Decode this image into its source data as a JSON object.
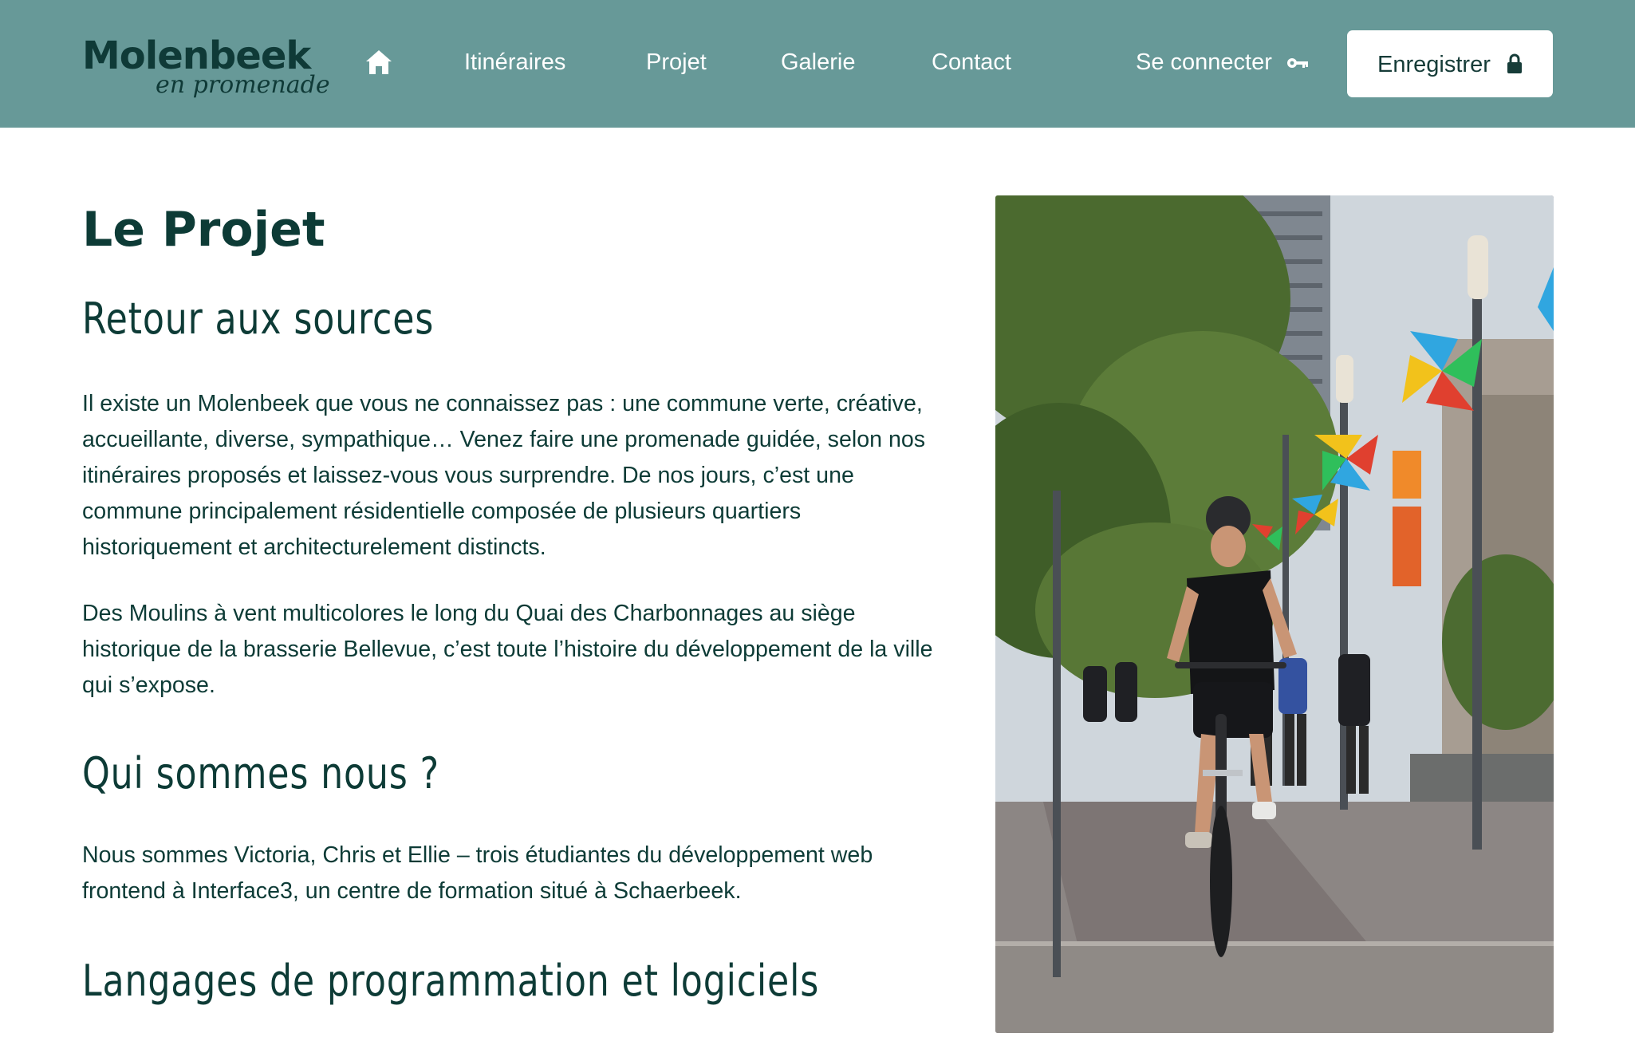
{
  "nav": {
    "logo": {
      "main": "Molenbeek",
      "sub": "en promenade"
    },
    "home_icon": "home-icon",
    "links": [
      "Itinéraires",
      "Projet",
      "Galerie",
      "Contact"
    ],
    "login_label": "Se connecter",
    "login_icon": "key-icon",
    "register_label": "Enregistrer",
    "register_icon": "lock-icon",
    "background": "#679998"
  },
  "main": {
    "title": "Le Projet",
    "sections": [
      {
        "heading": "Retour aux sources",
        "paragraphs": [
          "Il existe un Molenbeek que vous ne connaissez pas : une commune verte, créative, accueillante, diverse, sympathique… Venez faire une promenade guidée, selon nos itinéraires proposés et laissez-vous vous surprendre. De nos jours, c’est une commune principalement résidentielle composée de plusieurs quartiers historiquement et architecturelement distincts.",
          "Des Moulins à vent multicolores le long du Quai des Charbonnages au siège historique de la brasserie Bellevue, c’est toute l’histoire du développement de la ville qui s’expose."
        ]
      },
      {
        "heading": "Qui sommes nous ?",
        "paragraphs": [
          "Nous sommes Victoria, Chris et Ellie – trois étudiantes du développement web frontend à Interface3, un centre de formation situé à Schaerbeek."
        ]
      },
      {
        "heading": "Langages de programmation et logiciels",
        "paragraphs": []
      }
    ],
    "photo_subject": "cyclist-on-canal-quay-photo"
  },
  "colors": {
    "nav_bg": "#679998",
    "text_dark": "#0d3b36",
    "white": "#ffffff"
  }
}
